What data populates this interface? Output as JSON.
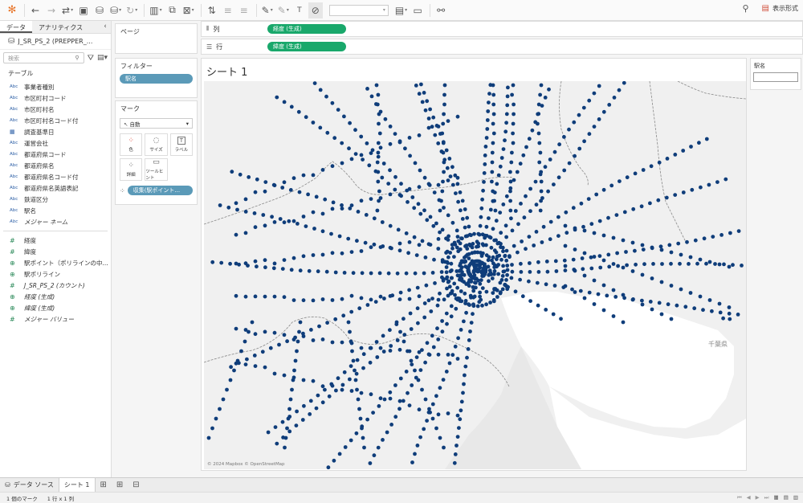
{
  "toolbar": {
    "logo_icon": "tableau-logo-icon",
    "items": [
      "undo-icon",
      "redo-icon",
      "swap-icon",
      "save-icon",
      "new-datasource-icon",
      "pause-icon",
      "refresh-icon",
      "chart-icon",
      "duplicate-sheet-icon",
      "clear-sheet-icon",
      "swap-rows-cols-icon",
      "sort-asc-icon",
      "sort-desc-icon",
      "highlight-icon",
      "group-icon",
      "label-icon",
      "fix-axes-icon",
      "fit-icon",
      "presentation-icon",
      "share-icon"
    ],
    "show_me_label": "表示形式"
  },
  "left_panel": {
    "tab_data": "データ",
    "tab_analytics": "アナリティクス",
    "datasource": "J_SR_PS_2 (PREPPER_...",
    "search_placeholder": "検索",
    "section_table": "テーブル",
    "dimensions": [
      {
        "type": "Abc",
        "name": "事業者種別"
      },
      {
        "type": "Abc",
        "name": "市区町村コード"
      },
      {
        "type": "Abc",
        "name": "市区町村名"
      },
      {
        "type": "Abc",
        "name": "市区町村名コード付"
      },
      {
        "type": "cal",
        "name": "調査基準日"
      },
      {
        "type": "Abc",
        "name": "運営会社"
      },
      {
        "type": "Abc",
        "name": "都道府県コード"
      },
      {
        "type": "Abc",
        "name": "都道府県名"
      },
      {
        "type": "Abc",
        "name": "都道府県名コード付"
      },
      {
        "type": "Abc",
        "name": "都道府県名英語表記"
      },
      {
        "type": "Abc",
        "name": "鉄道区分"
      },
      {
        "type": "Abc",
        "name": "駅名"
      },
      {
        "type": "Abc",
        "name": "メジャー ネーム",
        "italic": true
      }
    ],
    "measures": [
      {
        "type": "#",
        "name": "経度"
      },
      {
        "type": "#",
        "name": "緯度"
      },
      {
        "type": "geo",
        "name": "駅ポイント（ポリラインの中..."
      },
      {
        "type": "geo",
        "name": "駅ポリライン"
      },
      {
        "type": "#",
        "name": "J_SR_PS_2 (カウント)",
        "italic": true
      },
      {
        "type": "geo",
        "name": "経度 (生成)",
        "italic": true
      },
      {
        "type": "geo",
        "name": "緯度 (生成)",
        "italic": true
      },
      {
        "type": "#",
        "name": "メジャー バリュー",
        "italic": true
      }
    ]
  },
  "shelves": {
    "pages_label": "ページ",
    "filters_label": "フィルター",
    "filter_pill": "駅名",
    "marks_label": "マーク",
    "mark_type": "自動",
    "mark_buttons": [
      "色",
      "サイズ",
      "ラベル",
      "詳細",
      "ツールヒント"
    ],
    "detail_pill": "収集(駅ポイント...",
    "columns_label": "列",
    "columns_pill": "経度 (生成)",
    "rows_label": "行",
    "rows_pill": "緯度 (生成)"
  },
  "view": {
    "title": "シート 1",
    "attribution": "© 2024 Mapbox © OpenStreetMap",
    "place_label": "千葉県",
    "legend_title": "駅名"
  },
  "sheet_tabs": {
    "datasource_tab": "データ ソース",
    "sheet_tab": "シート 1"
  },
  "status": {
    "marks": "1 個のマーク",
    "dims": "1 行 x 1 列"
  },
  "colors": {
    "dot": "#0f3d7a",
    "pill_blue": "#5b9ab8",
    "pill_green": "#19a86b",
    "map_bg": "#f2f2f2",
    "water": "#ffffff"
  }
}
